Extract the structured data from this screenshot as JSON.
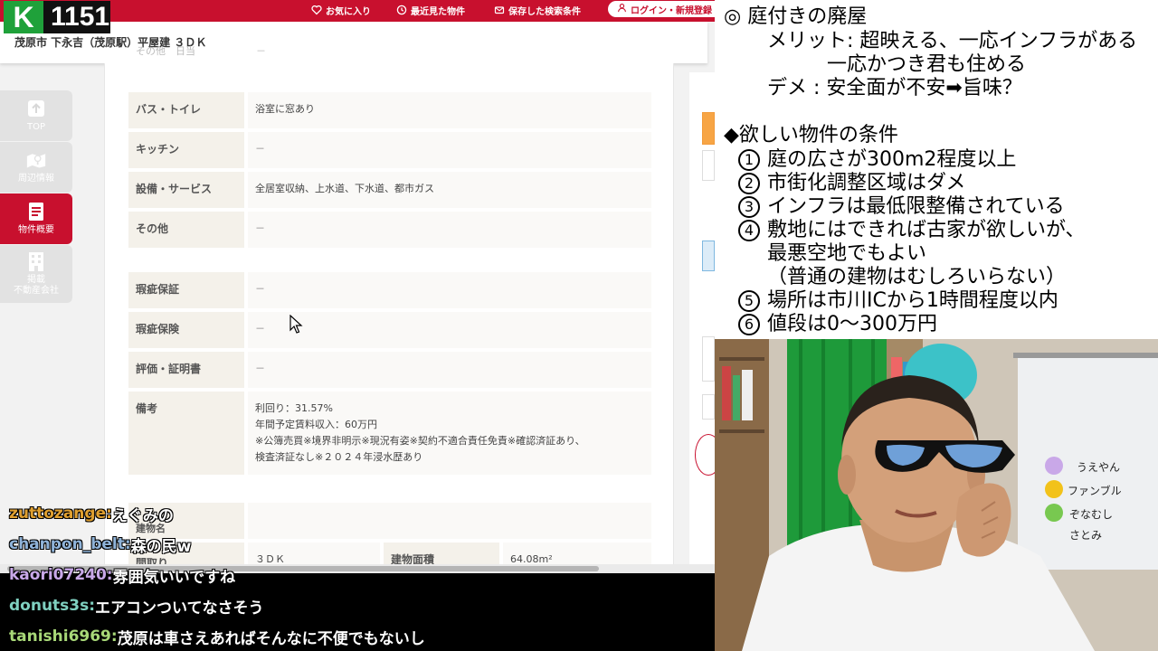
{
  "overlay": {
    "counter": "1151",
    "logo_letter": "K"
  },
  "topnav": {
    "favorites": "お気に入り",
    "recent": "最近見た物件",
    "saved_search": "保存した検索条件",
    "login": "ログイン・新規登録"
  },
  "header": {
    "title": "茂原市 下永吉（茂原駅）平屋建 ３ＤＫ",
    "ghost_label": "その他　日当",
    "ghost_value": "－"
  },
  "sidenav": [
    {
      "label": "TOP",
      "icon": "upload-arrow-icon"
    },
    {
      "label": "周辺情報",
      "icon": "map-pin-icon"
    },
    {
      "label": "物件概要",
      "icon": "document-icon",
      "active": true
    },
    {
      "label": "掲載\n不動産会社",
      "icon": "building-icon"
    }
  ],
  "details": [
    {
      "label": "バス・トイレ",
      "value": "浴室に窓あり"
    },
    {
      "label": "キッチン",
      "value": "－"
    },
    {
      "label": "設備・サービス",
      "value": "全居室収納、上水道、下水道、都市ガス"
    },
    {
      "label": "その他",
      "value": "－"
    },
    {
      "label": "瑕疵保証",
      "value": "－"
    },
    {
      "label": "瑕疵保険",
      "value": "－"
    },
    {
      "label": "評価・証明書",
      "value": "－"
    },
    {
      "label": "備考",
      "lines": [
        "利回り：31.57%",
        "年間予定賃料収入：60万円",
        "※公簿売買※境界非明示※現況有姿※契約不適合責任免責※確認済証あり、",
        "検査済証なし※２０２４年浸水歴あり"
      ]
    }
  ],
  "bottom_rows": {
    "building_name_label": "建物名",
    "madori_label": "間取り",
    "madori_value": "３ＤＫ",
    "area_label": "建物面積",
    "area_value": "64.08m²"
  },
  "chat": [
    {
      "user": "zuttozange:",
      "message": "えぐみの",
      "color": "#e0a030"
    },
    {
      "user": "chanpon_belt:",
      "message": "森の民w",
      "color": "#8fb3d9"
    },
    {
      "user": "kaori07240:",
      "message": "雰囲気いいですね",
      "color": "#c8a8e8"
    },
    {
      "user": "donuts3s:",
      "message": "エアコンついてなさそう",
      "color": "#7fd0c0"
    },
    {
      "user": "tanishi6969:",
      "message": "茂原は車さえあればそんなに不便でもないし",
      "color": "#a8d878"
    }
  ],
  "notes": {
    "title": "◎ 庭付きの廃屋",
    "merit_1": "メリット: 超映える、一応インフラがある",
    "merit_2": "一応かつき君も住める",
    "demerit": "デメ : 安全面が不安➡旨味？",
    "conditions_title": "◆欲しい物件の条件",
    "conditions": [
      {
        "num": "1",
        "text": "庭の広さが300m2程度以上"
      },
      {
        "num": "2",
        "text": "市街化調整区域はダメ"
      },
      {
        "num": "3",
        "text": "インフラは最低限整備されている"
      },
      {
        "num": "4",
        "text": "敷地にはできれば古家が欲しいが、"
      },
      {
        "num": "",
        "text": "最悪空地でもよい"
      },
      {
        "num": "",
        "text": "（普通の建物はむしろいらない）"
      },
      {
        "num": "5",
        "text": "場所は市川ICから1時間程度以内"
      },
      {
        "num": "6",
        "text": "値段は0〜300万円"
      }
    ]
  },
  "webcam": {
    "whiteboard_names": [
      "うえやん",
      "ファンブル",
      "ぞなむし",
      "さとみ"
    ]
  },
  "colors": {
    "brand_red": "#c8102e",
    "logo_green": "#1fa13a"
  }
}
